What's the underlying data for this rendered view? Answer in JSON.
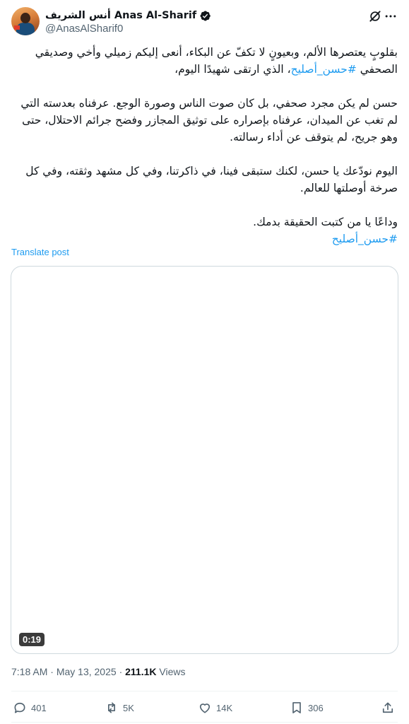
{
  "author": {
    "display_name": "أنس الشريف Anas Al-Sharif",
    "handle": "@AnasAlSharif0",
    "verified_icon": "verified-badge-icon",
    "avatar_icon": "avatar"
  },
  "tweet": {
    "p1_text": "بقلوبٍ يعتصرها الألم، وبعيونٍ لا تكفّ عن البكاء، أنعى إليكم زميلي وأخي وصديقي الصحفي ",
    "p1_hashtag": "#حسن_أصليح",
    "p1_tail": "، الذي ارتقى شهيدًا اليوم،",
    "p2": "حسن لم يكن مجرد صحفي، بل كان صوت الناس وصورة الوجع. عرفناه بعدسته التي لم تغب عن الميدان، عرفناه بإصراره على توثيق المجازر وفضح جرائم الاحتلال، حتى وهو جريح، لم يتوقف عن أداء رسالته.",
    "p3": "اليوم نودّعك يا حسن، لكنك ستبقى فينا، في ذاكرتنا، وفي كل مشهد وثقته، وفي كل صرخة أوصلتها للعالم.",
    "p4": "وداعًا يا من كتبت الحقيقة بدمك.",
    "final_hashtag": "#حسن_أصليح",
    "translate_label": "Translate post"
  },
  "media": {
    "duration": "0:19"
  },
  "meta": {
    "time": "7:18 AM",
    "separator": "·",
    "date": "May 13, 2025",
    "views_count": "211.1K",
    "views_label": "Views"
  },
  "actions": {
    "replies": "401",
    "reposts": "5K",
    "likes": "14K",
    "bookmarks": "306"
  },
  "colors": {
    "accent": "#1d9bf0",
    "text": "#0f1419",
    "secondary": "#536471",
    "border": "#cfd9de"
  }
}
